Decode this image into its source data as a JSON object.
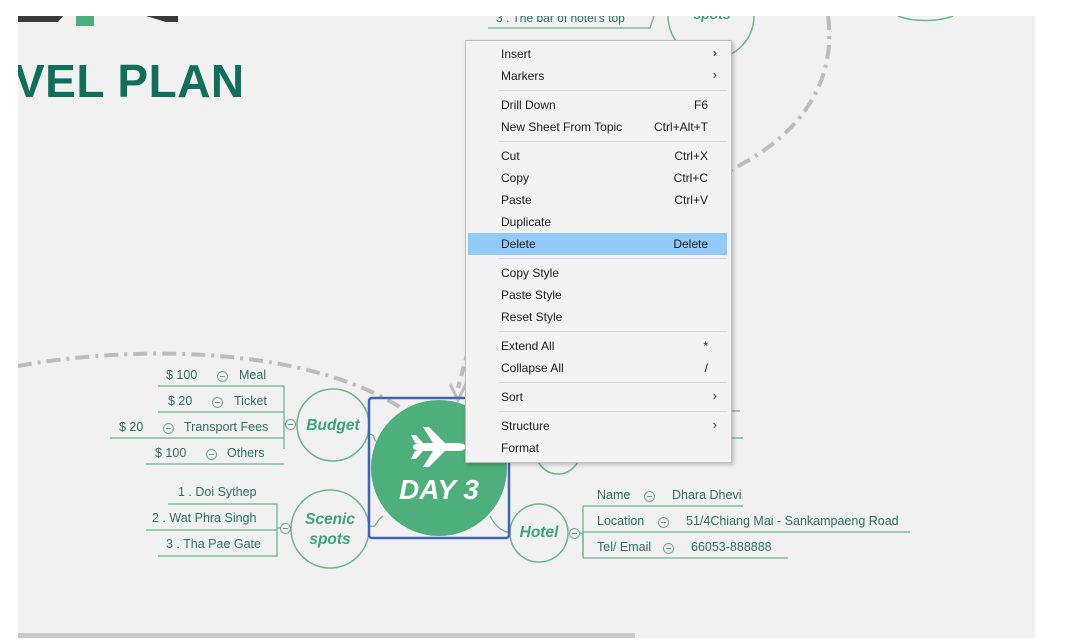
{
  "map": {
    "title": "VEL PLAN",
    "top_fragment": "3 . The bar of hotel's top",
    "top_node": "spots",
    "center": {
      "title": "DAY 3",
      "icon": "airplane-icon"
    },
    "budget": {
      "label": "Budget",
      "items": [
        {
          "amount": "$ 100",
          "name": "Meal"
        },
        {
          "amount": "$ 20",
          "name": "Ticket"
        },
        {
          "amount": "$ 20",
          "name": "Transport Fees"
        },
        {
          "amount": "$ 100",
          "name": "Others"
        }
      ]
    },
    "scenic": {
      "label_line1": "Scenic",
      "label_line2": "spots",
      "items": [
        "1 . Doi Sythep",
        "2 . Wat Phra Singh",
        "3 . Tha Pae Gate"
      ]
    },
    "hotel": {
      "label": "Hotel",
      "items": [
        {
          "key": "Name",
          "value": "Dhara Dhevi"
        },
        {
          "key": "Location",
          "value": "51/4Chiang Mai - Sankampaeng Road"
        },
        {
          "key": "Tel/ Email",
          "value": "66053-888888"
        }
      ]
    }
  },
  "context_menu": {
    "insert": {
      "label": "Insert",
      "submenu": true
    },
    "markers": {
      "label": "Markers",
      "submenu": true
    },
    "drill_down": {
      "label": "Drill Down",
      "shortcut": "F6"
    },
    "new_sheet": {
      "label": "New Sheet From Topic",
      "shortcut": "Ctrl+Alt+T"
    },
    "cut": {
      "label": "Cut",
      "shortcut": "Ctrl+X"
    },
    "copy": {
      "label": "Copy",
      "shortcut": "Ctrl+C"
    },
    "paste": {
      "label": "Paste",
      "shortcut": "Ctrl+V"
    },
    "duplicate": {
      "label": "Duplicate"
    },
    "delete": {
      "label": "Delete",
      "shortcut": "Delete",
      "highlighted": true
    },
    "copy_style": {
      "label": "Copy Style"
    },
    "paste_style": {
      "label": "Paste Style"
    },
    "reset_style": {
      "label": "Reset Style"
    },
    "extend_all": {
      "label": "Extend All",
      "shortcut": "*"
    },
    "collapse_all": {
      "label": "Collapse All",
      "shortcut": "/"
    },
    "sort": {
      "label": "Sort",
      "submenu": true
    },
    "structure": {
      "label": "Structure",
      "submenu": true
    },
    "format": {
      "label": "Format"
    }
  },
  "colors": {
    "accent": "#106f5a",
    "node_fill": "#4caf7c",
    "branch_text": "#3da27a",
    "selection_border": "#3f64b4",
    "menu_highlight": "#91c9f7",
    "canvas": "#f1f1f1"
  }
}
